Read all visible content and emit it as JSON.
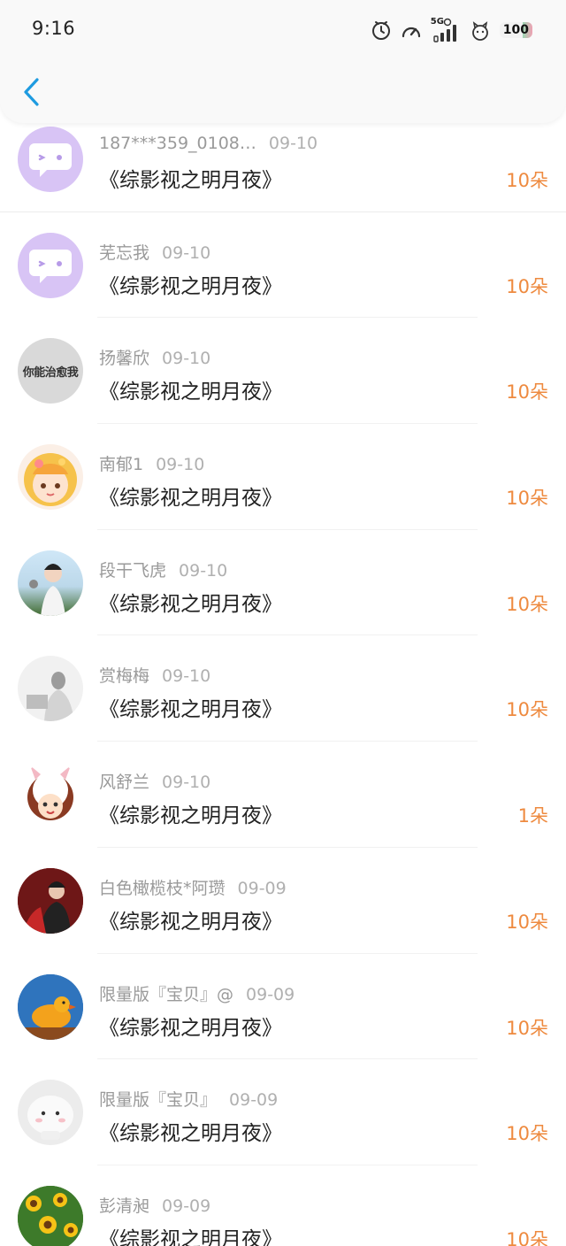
{
  "status_bar": {
    "time": "9:16",
    "network": "5G",
    "battery": "100"
  },
  "header": {
    "back_icon": "chevron-left-icon"
  },
  "list": [
    {
      "name": "187***359_0108…",
      "date": "09-10",
      "title": "《综影视之明月夜》",
      "count": "10朵",
      "avatar": "default-chat-bubble"
    },
    {
      "name": "芜忘我",
      "date": "09-10",
      "title": "《综影视之明月夜》",
      "count": "10朵",
      "avatar": "default-chat-bubble"
    },
    {
      "name": "扬馨欣",
      "date": "09-10",
      "title": "《综影视之明月夜》",
      "count": "10朵",
      "avatar": "text-avatar",
      "avatar_text": "你能治愈我"
    },
    {
      "name": "南郁1",
      "date": "09-10",
      "title": "《综影视之明月夜》",
      "count": "10朵",
      "avatar": "anime-girl"
    },
    {
      "name": "段干飞虎",
      "date": "09-10",
      "title": "《综影视之明月夜》",
      "count": "10朵",
      "avatar": "girl-photo"
    },
    {
      "name": "赏梅梅",
      "date": "09-10",
      "title": "《综影视之明月夜》",
      "count": "10朵",
      "avatar": "gray-photo"
    },
    {
      "name": "风舒兰",
      "date": "09-10",
      "title": "《综影视之明月夜》",
      "count": "1朵",
      "avatar": "bunny-cartoon"
    },
    {
      "name": "白色橄榄枝*阿瓒",
      "date": "09-09",
      "title": "《综影视之明月夜》",
      "count": "10朵",
      "avatar": "red-portrait"
    },
    {
      "name": "限量版『宝贝』@",
      "date": "09-09",
      "title": "《综影视之明月夜》",
      "count": "10朵",
      "avatar": "duck-photo"
    },
    {
      "name": "限量版『宝贝』",
      "date": "09-09",
      "title": "《综影视之明月夜》",
      "count": "10朵",
      "avatar": "plush-toy"
    },
    {
      "name": "彭清昶",
      "date": "09-09",
      "title": "《综影视之明月夜》",
      "count": "10朵",
      "avatar": "sunflowers"
    }
  ],
  "colors": {
    "accent_count": "#ee8a3f",
    "back_arrow": "#1e9be0",
    "default_avatar": "#d8c4f5"
  }
}
